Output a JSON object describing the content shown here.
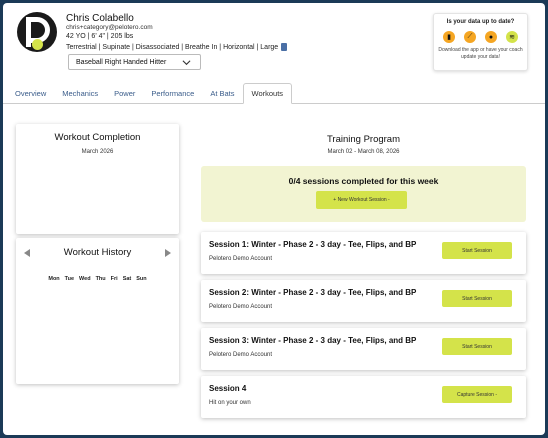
{
  "profile": {
    "name": "Chris Colabello",
    "email": "chris+category@pelotero.com",
    "stats": "42 YO | 6' 4\" | 205 lbs",
    "traits": "Terrestrial | Supinate | Disassociated | Breathe In | Horizontal | Large",
    "hitter_select": "Baseball Right Handed Hitter"
  },
  "update_box": {
    "title": "Is your data up to date?",
    "description": "Download the app or have your coach update your data!",
    "icons": [
      {
        "name": "camera-icon",
        "color": "#f5a623",
        "glyph": "▮"
      },
      {
        "name": "bat-icon",
        "color": "#f5a623",
        "glyph": "⟋"
      },
      {
        "name": "ball-icon",
        "color": "#f5a623",
        "glyph": "●"
      },
      {
        "name": "wifi-icon",
        "color": "#d4e34a",
        "glyph": "≋"
      }
    ]
  },
  "tabs": [
    "Overview",
    "Mechanics",
    "Power",
    "Performance",
    "At Bats",
    "Workouts"
  ],
  "active_tab": "Workouts",
  "workout_completion": {
    "title": "Workout Completion",
    "month": "March 2026"
  },
  "workout_history": {
    "title": "Workout History",
    "days": [
      "Mon",
      "Tue",
      "Wed",
      "Thu",
      "Fri",
      "Sat",
      "Sun"
    ]
  },
  "training_program": {
    "title": "Training Program",
    "range": "March 02 - March 08, 2026",
    "summary": "0/4 sessions completed for this week",
    "new_session_label": "+ New Workout Session  -"
  },
  "sessions": [
    {
      "title": "Session 1: Winter - Phase 2 - 3 day - Tee, Flips, and BP",
      "subtitle": "Pelotero Demo Account",
      "button": "Start Session"
    },
    {
      "title": "Session 2: Winter - Phase 2 - 3 day - Tee, Flips, and BP",
      "subtitle": "Pelotero Demo Account",
      "button": "Start Session"
    },
    {
      "title": "Session 3: Winter - Phase 2 - 3 day - Tee, Flips, and BP",
      "subtitle": "Pelotero Demo Account",
      "button": "Start Session"
    },
    {
      "title": "Session 4",
      "subtitle": "Hit on your own",
      "button": "Capture Session  -"
    }
  ],
  "colors": {
    "accent": "#d4e34a",
    "link": "#3a5c8a",
    "frame": "#1b3a57"
  }
}
